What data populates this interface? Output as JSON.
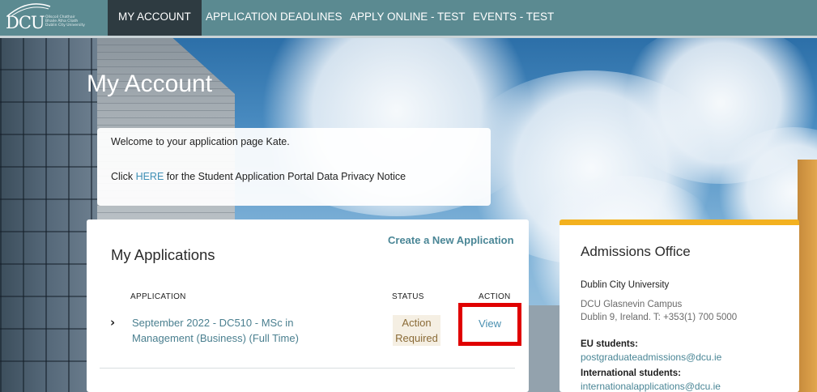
{
  "logo": {
    "text": "DCU",
    "subtitle_lines": [
      "Ollscoil Chathair",
      "Bhaile Átha Cliath",
      "Dublin City University"
    ]
  },
  "nav": {
    "items": [
      {
        "label": "MY ACCOUNT",
        "active": true
      },
      {
        "label": "APPLICATION DEADLINES",
        "active": false
      },
      {
        "label": "APPLY ONLINE - TEST",
        "active": false
      },
      {
        "label": "EVENTS - TEST",
        "active": false
      }
    ]
  },
  "page": {
    "title": "My Account"
  },
  "welcome": {
    "line1": "Welcome to your application page Kate.",
    "line2_prefix": "Click ",
    "line2_link": "HERE",
    "line2_suffix": " for the Student Application Portal Data Privacy Notice"
  },
  "applications": {
    "title": "My Applications",
    "create_link": "Create a New Application",
    "columns": {
      "application": "APPLICATION",
      "status": "STATUS",
      "action": "ACTION"
    },
    "rows": [
      {
        "name": "September 2022 - DC510 - MSc in Management (Business) (Full Time)",
        "status": "Action Required",
        "action": "View"
      }
    ]
  },
  "admissions": {
    "title": "Admissions Office",
    "org": "Dublin City University",
    "address1": "DCU Glasnevin Campus",
    "address2": "Dublin 9, Ireland. T: +353(1) 700 5000",
    "eu_label": "EU students:",
    "eu_email": "postgraduateadmissions@dcu.ie",
    "intl_label": "International students:",
    "intl_email": "internationalapplications@dcu.ie"
  },
  "colors": {
    "nav_bg": "#5b8a91",
    "nav_active": "#2e3b41",
    "accent_yellow": "#f3b11f",
    "link": "#4a8696",
    "highlight_red": "#e00000"
  }
}
